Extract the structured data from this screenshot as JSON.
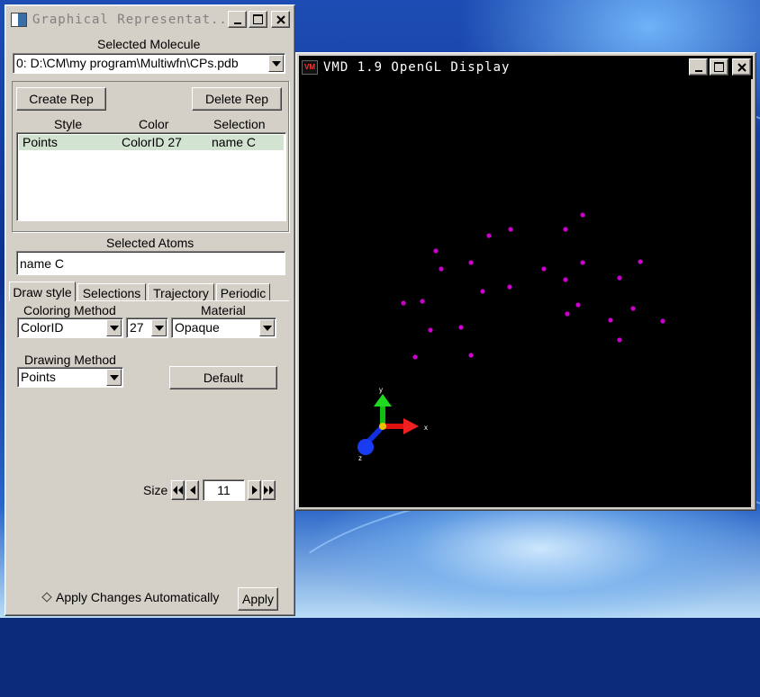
{
  "graphics_window": {
    "title": "Graphical Representat...",
    "selected_molecule_label": "Selected Molecule",
    "selected_molecule_value": "0: D:\\CM\\my program\\Multiwfn\\CPs.pdb",
    "create_rep_label": "Create Rep",
    "delete_rep_label": "Delete Rep",
    "table_headers": {
      "style": "Style",
      "color": "Color",
      "selection": "Selection"
    },
    "rows": [
      {
        "style": "Points",
        "color": "ColorID 27",
        "selection": "name C"
      }
    ],
    "selected_atoms_label": "Selected Atoms",
    "selected_atoms_value": "name C",
    "tabs": {
      "draw_style": "Draw style",
      "selections": "Selections",
      "trajectory": "Trajectory",
      "periodic": "Periodic"
    },
    "coloring_method_label": "Coloring Method",
    "coloring_method_value": "ColorID",
    "color_id_value": "27",
    "material_label": "Material",
    "material_value": "Opaque",
    "drawing_method_label": "Drawing Method",
    "drawing_method_value": "Points",
    "default_label": "Default",
    "size_label": "Size",
    "size_value": "11",
    "apply_auto_label": "Apply Changes Automatically",
    "apply_label": "Apply"
  },
  "display_window": {
    "title": "VMD 1.9 OpenGL Display",
    "app_icon_text": "VM",
    "axis_labels": {
      "x": "x",
      "y": "y",
      "z": "z"
    }
  },
  "colors": {
    "point": "#cc00cc",
    "display_bg": "#000000",
    "selected_row": "#d2e3d2",
    "axis_x": "#e01010",
    "axis_y": "#10c010",
    "axis_z": "#1030e0"
  }
}
